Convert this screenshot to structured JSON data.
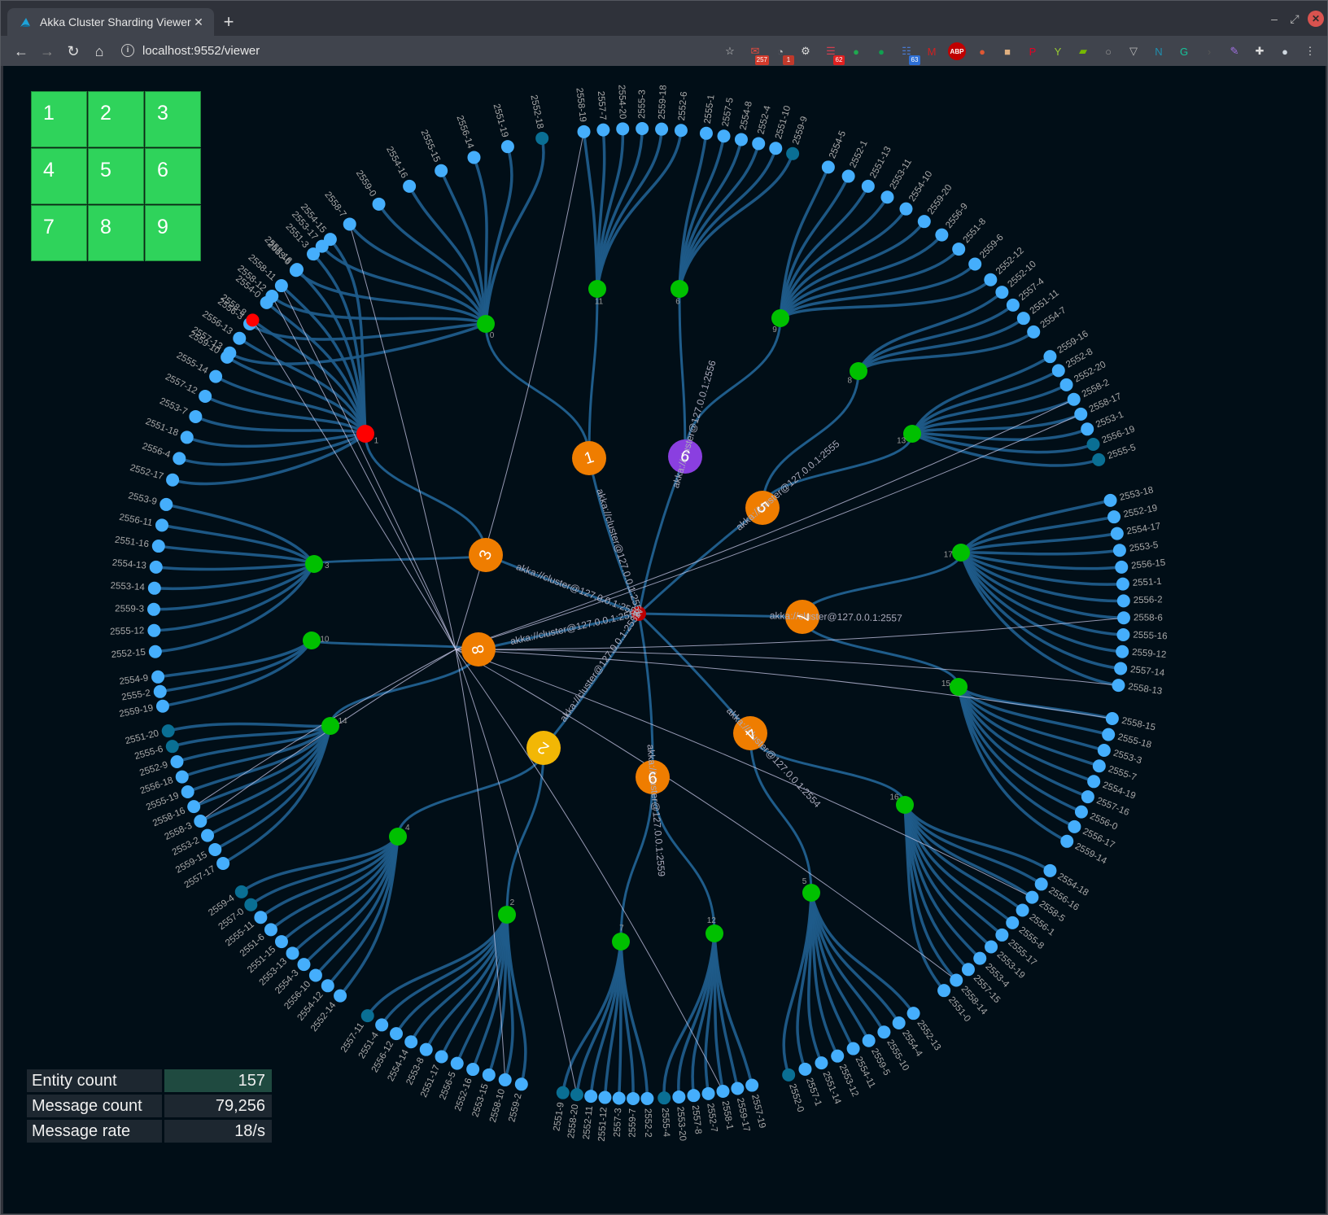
{
  "browser": {
    "tab_title": "Akka Cluster Sharding Viewer",
    "tab_close": "✕",
    "new_tab": "+",
    "url": "localhost:9552/viewer",
    "nav": {
      "back": "←",
      "forward": "→",
      "reload": "↻",
      "home": "⌂",
      "info": "i"
    },
    "window_controls": {
      "minimize": "–",
      "restore": "⤢",
      "close": "✕"
    },
    "extensions": [
      {
        "name": "bookmark-star-icon",
        "glyph": "☆",
        "color": "#cccccc"
      },
      {
        "name": "gmail-icon",
        "glyph": "✉",
        "color": "#e34b3f",
        "badge": "257",
        "badge_color": "#d33b2c"
      },
      {
        "name": "extension-o-icon",
        "glyph": "◔",
        "color": "#bbbbbb",
        "badge": "1",
        "badge_color": "#c0392b"
      },
      {
        "name": "settings-gear-icon",
        "glyph": "⚙",
        "color": "#dddddd"
      },
      {
        "name": "tab-stack-icon",
        "glyph": "☰",
        "color": "#d04050",
        "badge": "62",
        "badge_color": "#e02020"
      },
      {
        "name": "evernote-icon",
        "glyph": "●",
        "color": "#1fa84f"
      },
      {
        "name": "green-leaf-icon",
        "glyph": "●",
        "color": "#10a050"
      },
      {
        "name": "list-counter-icon",
        "glyph": "☷",
        "color": "#4a7ad0",
        "badge": "63",
        "badge_color": "#2d6fd6"
      },
      {
        "name": "mail-checker-icon",
        "glyph": "M",
        "color": "#d02020"
      },
      {
        "name": "adblock-plus-icon",
        "glyph": "ABP",
        "color": "#c00000"
      },
      {
        "name": "duckduckgo-icon",
        "glyph": "●",
        "color": "#de5833"
      },
      {
        "name": "face-icon",
        "glyph": "■",
        "color": "#e0b080"
      },
      {
        "name": "pinterest-icon",
        "glyph": "P",
        "color": "#e60023"
      },
      {
        "name": "plant-icon",
        "glyph": "Y",
        "color": "#9acd32"
      },
      {
        "name": "nvidia-icon",
        "glyph": "▰",
        "color": "#76b900"
      },
      {
        "name": "circle-outline-icon",
        "glyph": "○",
        "color": "#999999"
      },
      {
        "name": "pocket-icon",
        "glyph": "▽",
        "color": "#bbbbbb"
      },
      {
        "name": "n-bracket-icon",
        "glyph": "N",
        "color": "#1f8fb0"
      },
      {
        "name": "grammarly-icon",
        "glyph": "G",
        "color": "#15c39a"
      },
      {
        "name": "arrow-faded-icon",
        "glyph": "›",
        "color": "#555555"
      },
      {
        "name": "pen-icon",
        "glyph": "✎",
        "color": "#a070e0"
      },
      {
        "name": "extensions-puzzle-icon",
        "glyph": "✚",
        "color": "#dddddd"
      },
      {
        "name": "profile-avatar-icon",
        "glyph": "●",
        "color": "#cfd8e0"
      },
      {
        "name": "menu-kebab-icon",
        "glyph": "⋮",
        "color": "#dddddd"
      }
    ]
  },
  "grid": {
    "cells": [
      "1",
      "2",
      "3",
      "4",
      "5",
      "6",
      "7",
      "8",
      "9"
    ],
    "color": "#2fd35b"
  },
  "stats": [
    {
      "label": "Entity count",
      "value": "157"
    },
    {
      "label": "Message count",
      "value": "79,256"
    },
    {
      "label": "Message rate",
      "value": "18/s"
    }
  ],
  "colors": {
    "background": "#010e17",
    "cluster_node": "#c00000",
    "member_orange": "#ef7d00",
    "member_yellow": "#f2b705",
    "member_purple": "#8a3fe0",
    "shard": "#00c000",
    "entity": "#45aefc",
    "entity_dim": "#0a6f94",
    "entity_alert": "#ff0000",
    "link": "#1f5c8a",
    "message_line": "#c8c8e8"
  },
  "graph": {
    "cluster": {
      "label": "cluster"
    },
    "members": [
      {
        "id": "1",
        "address": "akka://cluster@127.0.0.1:2551",
        "color": "orange"
      },
      {
        "id": "2",
        "address": "akka://cluster@127.0.0.1:2552",
        "color": "yellow"
      },
      {
        "id": "3",
        "address": "akka://cluster@127.0.0.1:2553",
        "color": "orange"
      },
      {
        "id": "4",
        "address": "akka://cluster@127.0.0.1:2554",
        "color": "orange"
      },
      {
        "id": "5",
        "address": "akka://cluster@127.0.0.1:2555",
        "color": "orange"
      },
      {
        "id": "6",
        "address": "akka://cluster@127.0.0.1:2556",
        "color": "purple"
      },
      {
        "id": "7",
        "address": "akka://cluster@127.0.0.1:2557",
        "color": "orange"
      },
      {
        "id": "8",
        "address": "akka://cluster@127.0.0.1:2558",
        "color": "orange"
      },
      {
        "id": "9",
        "address": "akka://cluster@127.0.0.1:2559",
        "color": "orange"
      }
    ],
    "shards": [
      {
        "id": "0",
        "member": "1",
        "entities": [
          "2557-13",
          "2556-3",
          "2558-12",
          "2553-6",
          "2553-17",
          "2558-7",
          "2559-0",
          "2554-16",
          "2555-15",
          "2556-14",
          "2551-19",
          "2552-18"
        ],
        "dim": [
          "2552-18"
        ]
      },
      {
        "id": "11",
        "member": "1",
        "entities": [
          "2558-19",
          "2557-7",
          "2554-20",
          "2555-3",
          "2559-18",
          "2552-6"
        ],
        "dim": []
      },
      {
        "id": "6",
        "member": "6",
        "entities": [
          "2555-1",
          "2557-5",
          "2554-8",
          "2552-4",
          "2551-10",
          "2559-9"
        ],
        "dim": [
          "2559-9"
        ]
      },
      {
        "id": "9",
        "member": "6",
        "entities": [
          "2554-5",
          "2552-1",
          "2551-13",
          "2553-11",
          "2554-10",
          "2559-20",
          "2556-9",
          "2551-8",
          "2559-6",
          "2552-12"
        ],
        "dim": []
      },
      {
        "id": "8",
        "member": "5",
        "entities": [
          "2552-10",
          "2557-4",
          "2551-11",
          "2554-7"
        ],
        "dim": []
      },
      {
        "id": "13",
        "member": "5",
        "entities": [
          "2559-16",
          "2552-8",
          "2552-20",
          "2558-2",
          "2558-17",
          "2553-1",
          "2556-19",
          "2555-5"
        ],
        "dim": [
          "2556-19",
          "2555-5"
        ]
      },
      {
        "id": "17",
        "member": "7",
        "entities": [
          "2553-18",
          "2552-19",
          "2554-17",
          "2553-5",
          "2556-15",
          "2551-1",
          "2556-2",
          "2558-6",
          "2555-16",
          "2559-12",
          "2557-14",
          "2558-13"
        ],
        "dim": []
      },
      {
        "id": "15",
        "member": "7",
        "entities": [
          "2558-15",
          "2555-18",
          "2553-3",
          "2555-7",
          "2554-19",
          "2557-16",
          "2556-0",
          "2556-17",
          "2559-14"
        ],
        "dim": []
      },
      {
        "id": "16",
        "member": "4",
        "entities": [
          "2554-18",
          "2556-16",
          "2558-5",
          "2556-1",
          "2555-8",
          "2555-17",
          "2553-19",
          "2553-4",
          "2557-15",
          "2558-14",
          "2551-0"
        ],
        "dim": []
      },
      {
        "id": "5",
        "member": "4",
        "entities": [
          "2552-13",
          "2554-4",
          "2555-10",
          "2559-5",
          "2554-11",
          "2553-12",
          "2551-14",
          "2557-1",
          "2552-0"
        ],
        "dim": [
          "2552-0"
        ]
      },
      {
        "id": "12",
        "member": "9",
        "entities": [
          "2557-19",
          "2559-17",
          "2558-1",
          "2552-7",
          "2557-8",
          "2553-20",
          "2555-4"
        ],
        "dim": [
          "2555-4"
        ]
      },
      {
        "id": "7",
        "member": "9",
        "entities": [
          "2552-2",
          "2559-7",
          "2557-3",
          "2551-12",
          "2552-11",
          "2558-20",
          "2551-9"
        ],
        "dim": [
          "2558-20",
          "2551-9"
        ]
      },
      {
        "id": "2",
        "member": "2",
        "entities": [
          "2559-2",
          "2558-10",
          "2553-15",
          "2552-16",
          "2556-5",
          "2551-17",
          "2553-8",
          "2554-14",
          "2556-12",
          "2551-4",
          "2557-11"
        ],
        "dim": [
          "2557-11"
        ]
      },
      {
        "id": "4",
        "member": "2",
        "entities": [
          "2552-14",
          "2554-12",
          "2556-10",
          "2554-3",
          "2553-13",
          "2551-15",
          "2551-6",
          "2555-11",
          "2557-0",
          "2559-4"
        ],
        "dim": [
          "2557-0",
          "2559-4"
        ]
      },
      {
        "id": "14",
        "member": "8",
        "entities": [
          "2557-17",
          "2559-15",
          "2553-2",
          "2558-3",
          "2558-16",
          "2555-19",
          "2556-18",
          "2552-9",
          "2555-6",
          "2551-20"
        ],
        "dim": [
          "2555-6",
          "2551-20"
        ]
      },
      {
        "id": "10",
        "member": "8",
        "entities": [
          "2559-19",
          "2555-2",
          "2554-9"
        ],
        "dim": []
      },
      {
        "id": "3",
        "member": "3",
        "entities": [
          "2552-15",
          "2555-12",
          "2559-3",
          "2553-14",
          "2554-13",
          "2551-16",
          "2556-11",
          "2553-9"
        ],
        "dim": []
      },
      {
        "id": "1",
        "member": "3",
        "entities": [
          "2552-17",
          "2556-4",
          "2551-18",
          "2553-7",
          "2557-12",
          "2555-14",
          "2559-10",
          "2556-13",
          "2558-8",
          "2554-0",
          "2558-11",
          "2553-16",
          "2551-3",
          "2554-15"
        ],
        "dim": [],
        "alert": [
          "2558-8"
        ],
        "alert_shard": true
      }
    ],
    "message_flows": [
      "2558-19",
      "2558-12",
      "2558-7",
      "2558-11",
      "2558-8",
      "2558-16",
      "2558-3",
      "2558-17",
      "2558-2",
      "2558-6",
      "2558-13",
      "2558-15",
      "2558-5",
      "2558-14",
      "2558-10",
      "2558-20",
      "2558-1"
    ]
  }
}
